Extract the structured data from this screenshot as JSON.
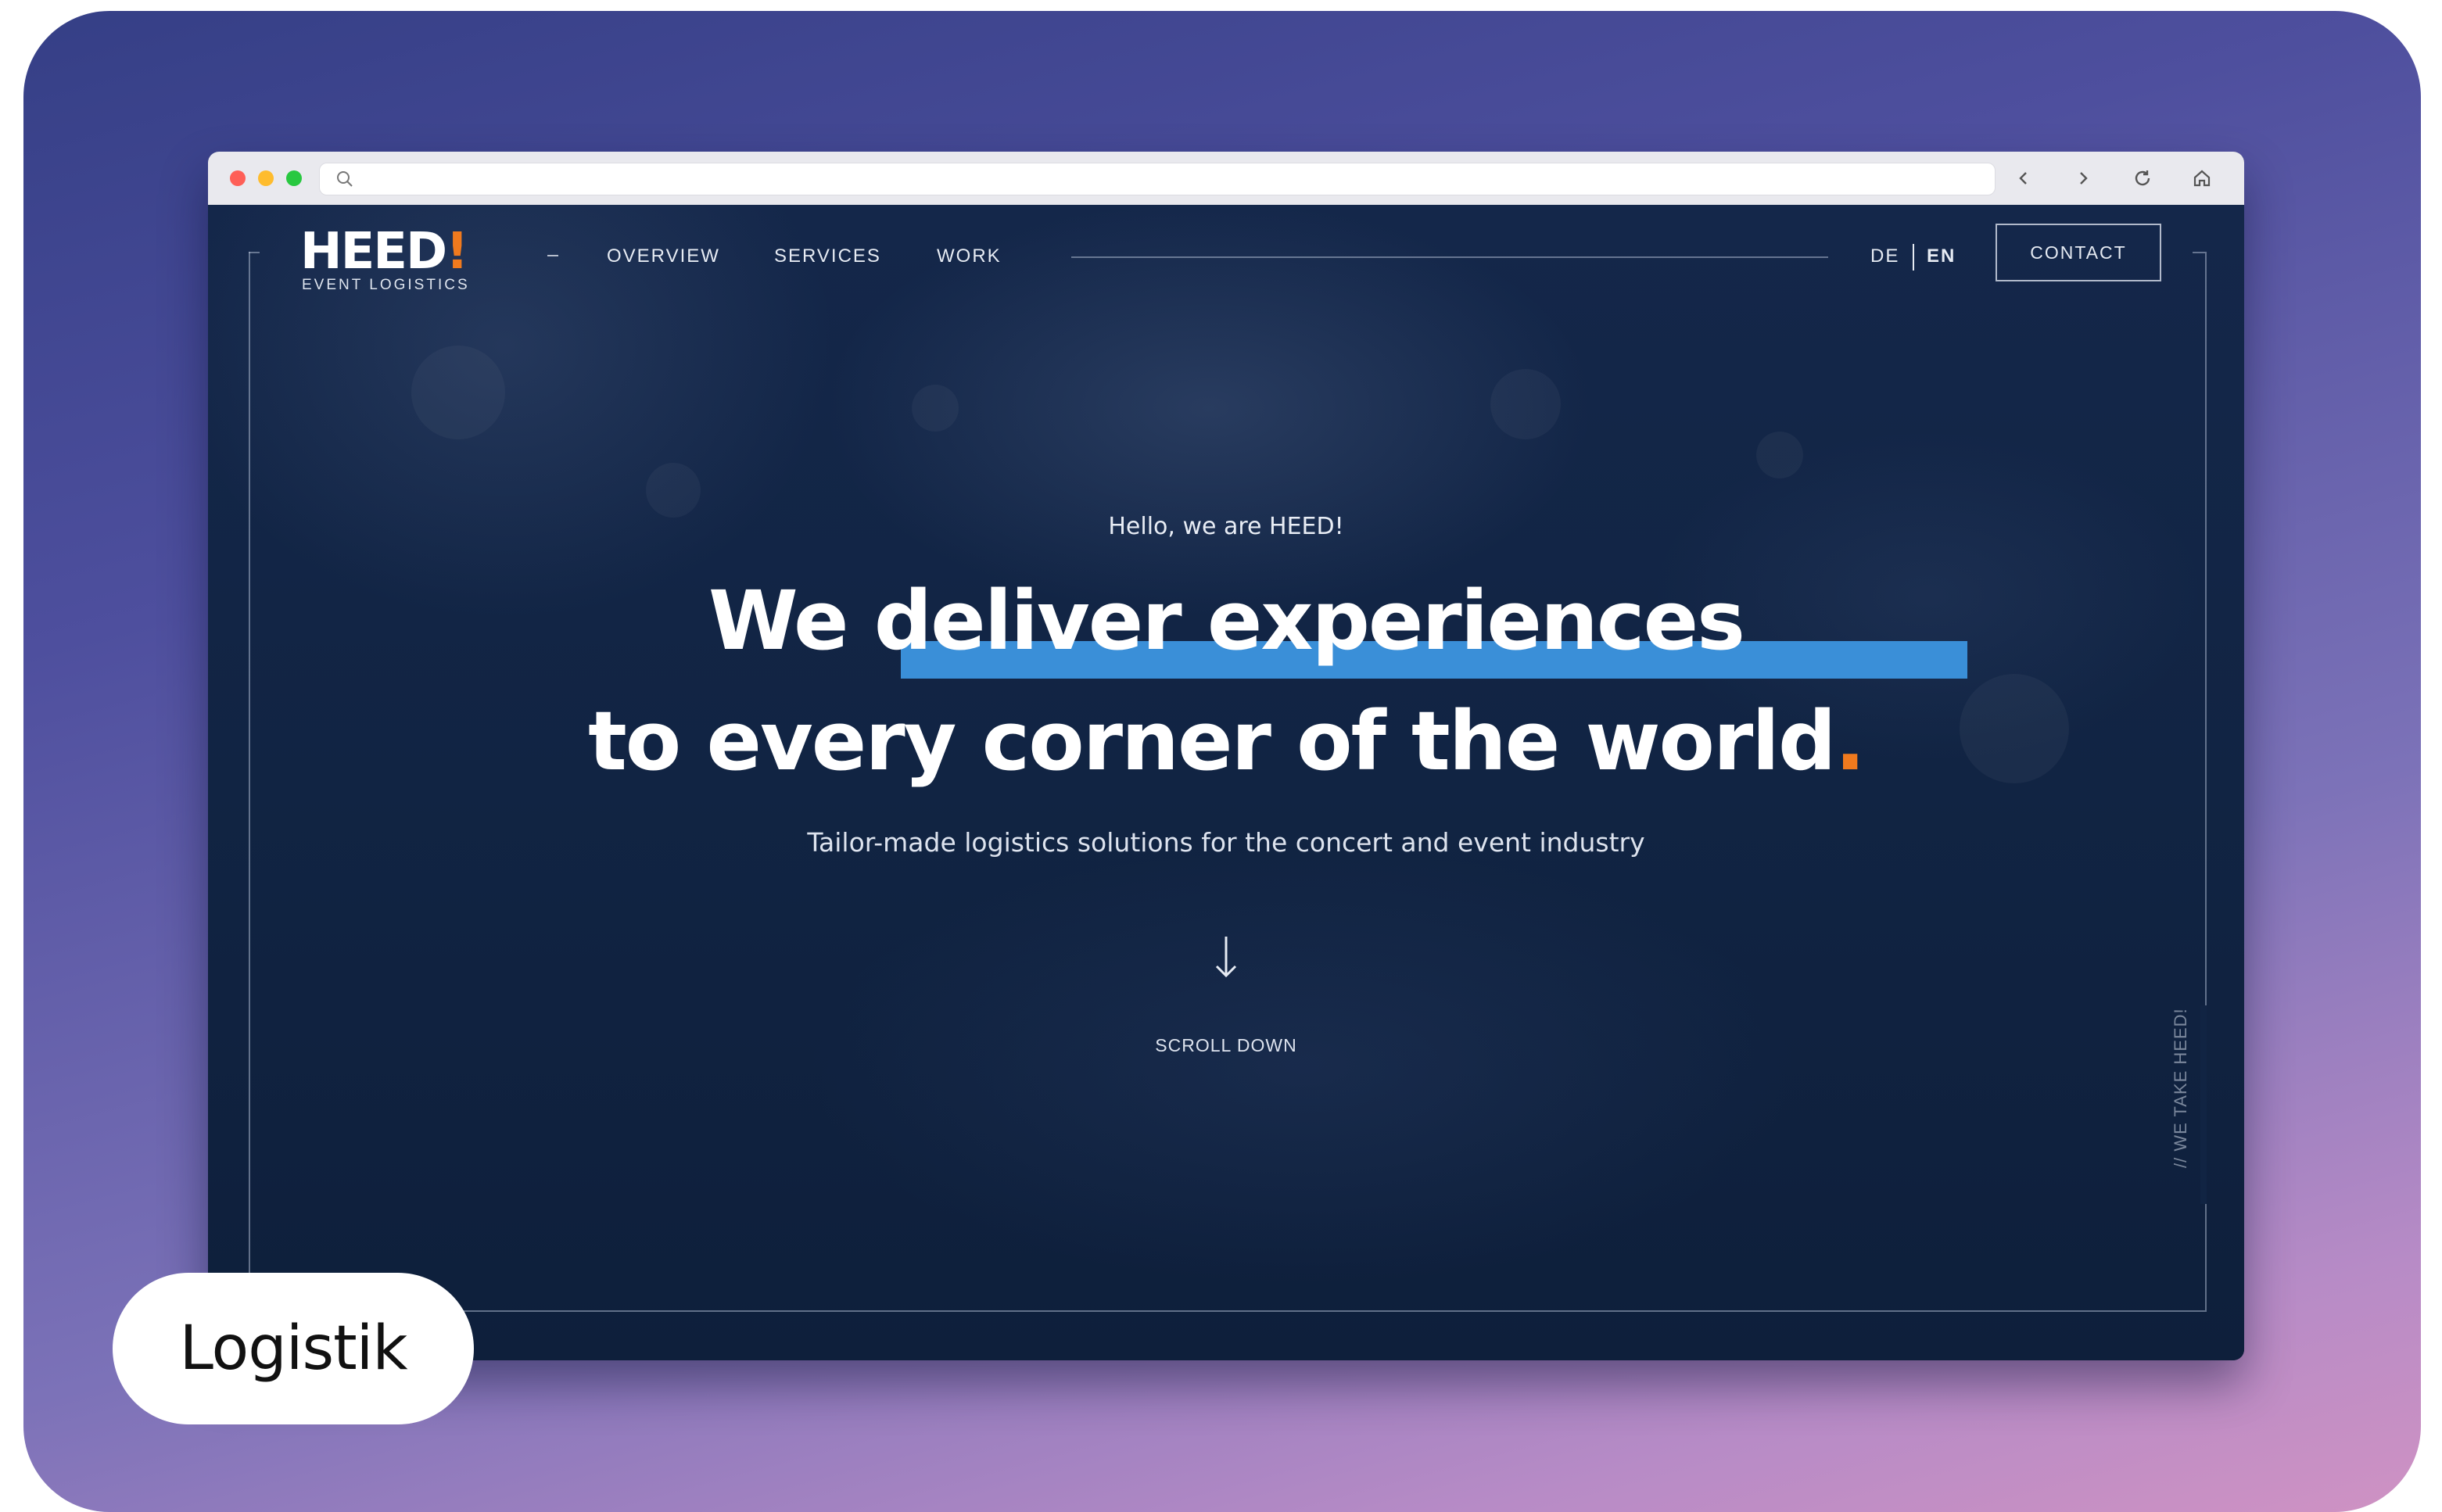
{
  "nav": {
    "logo": {
      "main": "HEED",
      "bang": "!",
      "sub": "EVENT LOGISTICS"
    },
    "items": [
      {
        "label": "OVERVIEW"
      },
      {
        "label": "SERVICES"
      },
      {
        "label": "WORK"
      }
    ],
    "languages": [
      {
        "label": "DE",
        "active": false
      },
      {
        "label": "EN",
        "active": true
      }
    ],
    "contact_label": "CONTACT"
  },
  "hero": {
    "hello": "Hello, we are HEED!",
    "headline_line1": "We deliver experiences",
    "headline_line2": "to every corner of the world",
    "headline_dot": ".",
    "tagline": "Tailor-made logistics solutions for the concert and event industry",
    "scroll_label": "SCROLL DOWN",
    "vertical_text": "// WE TAKE HEED!"
  },
  "badge": {
    "label": "Logistik"
  },
  "colors": {
    "accent_blue": "#3a8fd8",
    "accent_orange": "#f07a1e",
    "page_bg": "#112443"
  },
  "icons": {
    "url_search": "search-icon",
    "back": "chevron-left-icon",
    "forward": "chevron-right-icon",
    "reload": "reload-icon",
    "home": "home-icon",
    "scroll": "arrow-down-icon"
  }
}
